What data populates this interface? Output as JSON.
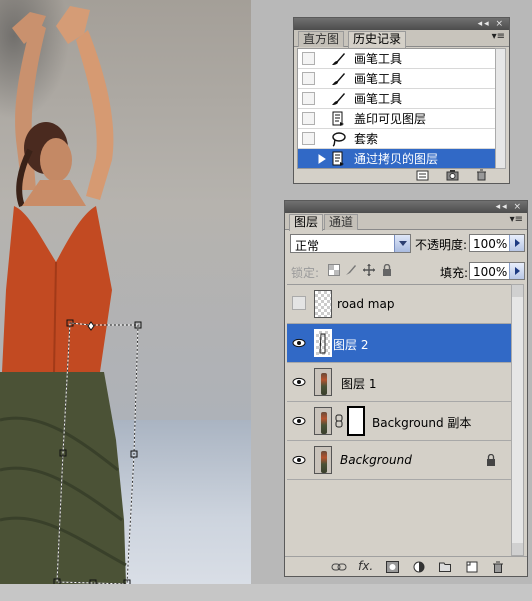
{
  "history_panel": {
    "titlebar_buttons": "◂◂ ×",
    "tabs": [
      {
        "label": "直方图",
        "active": false
      },
      {
        "label": "历史记录",
        "active": true
      }
    ],
    "menu_glyph": "▾≡",
    "items": [
      {
        "label": "画笔工具",
        "icon": "brush-icon",
        "selected": false
      },
      {
        "label": "画笔工具",
        "icon": "brush-icon",
        "selected": false
      },
      {
        "label": "画笔工具",
        "icon": "brush-icon",
        "selected": false
      },
      {
        "label": "盖印可见图层",
        "icon": "document-step-icon",
        "selected": false
      },
      {
        "label": "套索",
        "icon": "lasso-icon",
        "selected": false
      },
      {
        "label": "通过拷贝的图层",
        "icon": "document-step-icon",
        "selected": true
      }
    ],
    "footer_icons": [
      "new-document-from-state-icon",
      "snapshot-camera-icon",
      "trash-icon"
    ]
  },
  "layers_panel": {
    "titlebar_buttons": "◂◂ ×",
    "tabs": [
      {
        "label": "图层",
        "active": true
      },
      {
        "label": "通道",
        "active": false
      }
    ],
    "menu_glyph": "▾≡",
    "blend_mode": "正常",
    "opacity_label": "不透明度:",
    "opacity_value": "100%",
    "lock_label": "锁定:",
    "fill_label": "填充:",
    "fill_value": "100%",
    "layers": [
      {
        "name": "road map",
        "visible": false,
        "thumb": "transparent",
        "selected": false
      },
      {
        "name": "图层 2",
        "visible": true,
        "thumb": "transparent-selection",
        "selected": true
      },
      {
        "name": "图层 1",
        "visible": true,
        "thumb": "photo",
        "selected": false
      },
      {
        "name": "Background 副本",
        "visible": true,
        "thumb": "photo",
        "mask": true,
        "selected": false
      },
      {
        "name": "Background",
        "visible": true,
        "thumb": "photo",
        "locked": true,
        "italic": true,
        "selected": false
      }
    ],
    "footer_icons": [
      "link-layers-icon",
      "fx-icon",
      "add-mask-icon",
      "adjustment-layer-icon",
      "new-group-icon",
      "new-layer-icon",
      "delete-layer-icon"
    ],
    "footer_fx_text": "fx."
  },
  "colors": {
    "selection": "#3169c6",
    "panel_bg": "#d4d0c8",
    "titlebar": "#4c4c4c"
  }
}
